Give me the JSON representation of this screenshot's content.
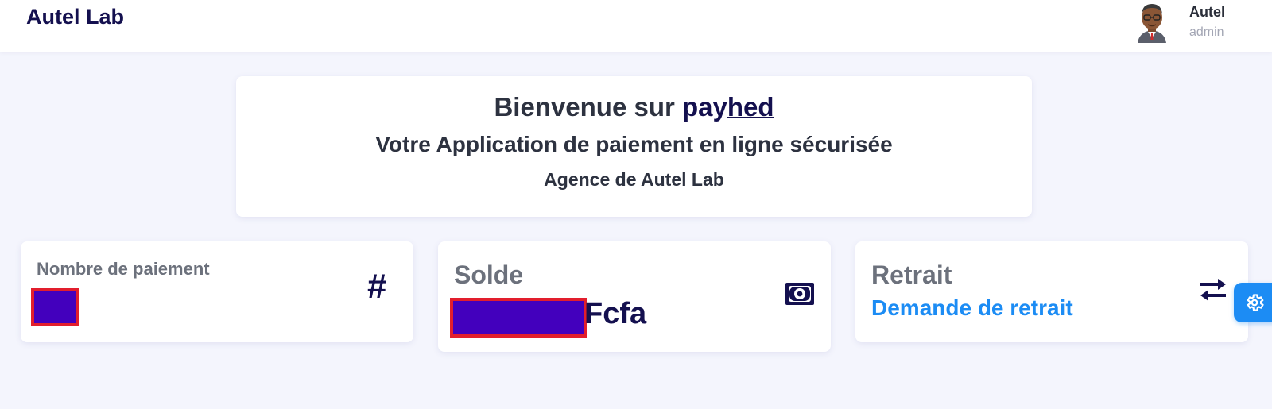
{
  "header": {
    "brand": "Autel Lab",
    "user": {
      "name": "Autel",
      "role": "admin"
    }
  },
  "welcome": {
    "line1_prefix": "Bienvenue sur ",
    "logo_part1": "pay",
    "logo_part2": "hed",
    "line2": "Votre Application de paiement en ligne sécurisée",
    "line3": "Agence de Autel Lab"
  },
  "stats": [
    {
      "title": "Nombre de paiement",
      "icon": "hash-icon"
    },
    {
      "title": "Solde",
      "suffix": "Fcfa",
      "icon": "money-bill-icon"
    },
    {
      "title": "Retrait",
      "link": "Demande de retrait",
      "icon": "transfer-icon"
    }
  ],
  "colors": {
    "primary": "#14104f",
    "accent": "#1c8cf4",
    "background": "#f4f5fd",
    "redaction_fill": "#4300bd",
    "redaction_border": "#e21e2d"
  }
}
